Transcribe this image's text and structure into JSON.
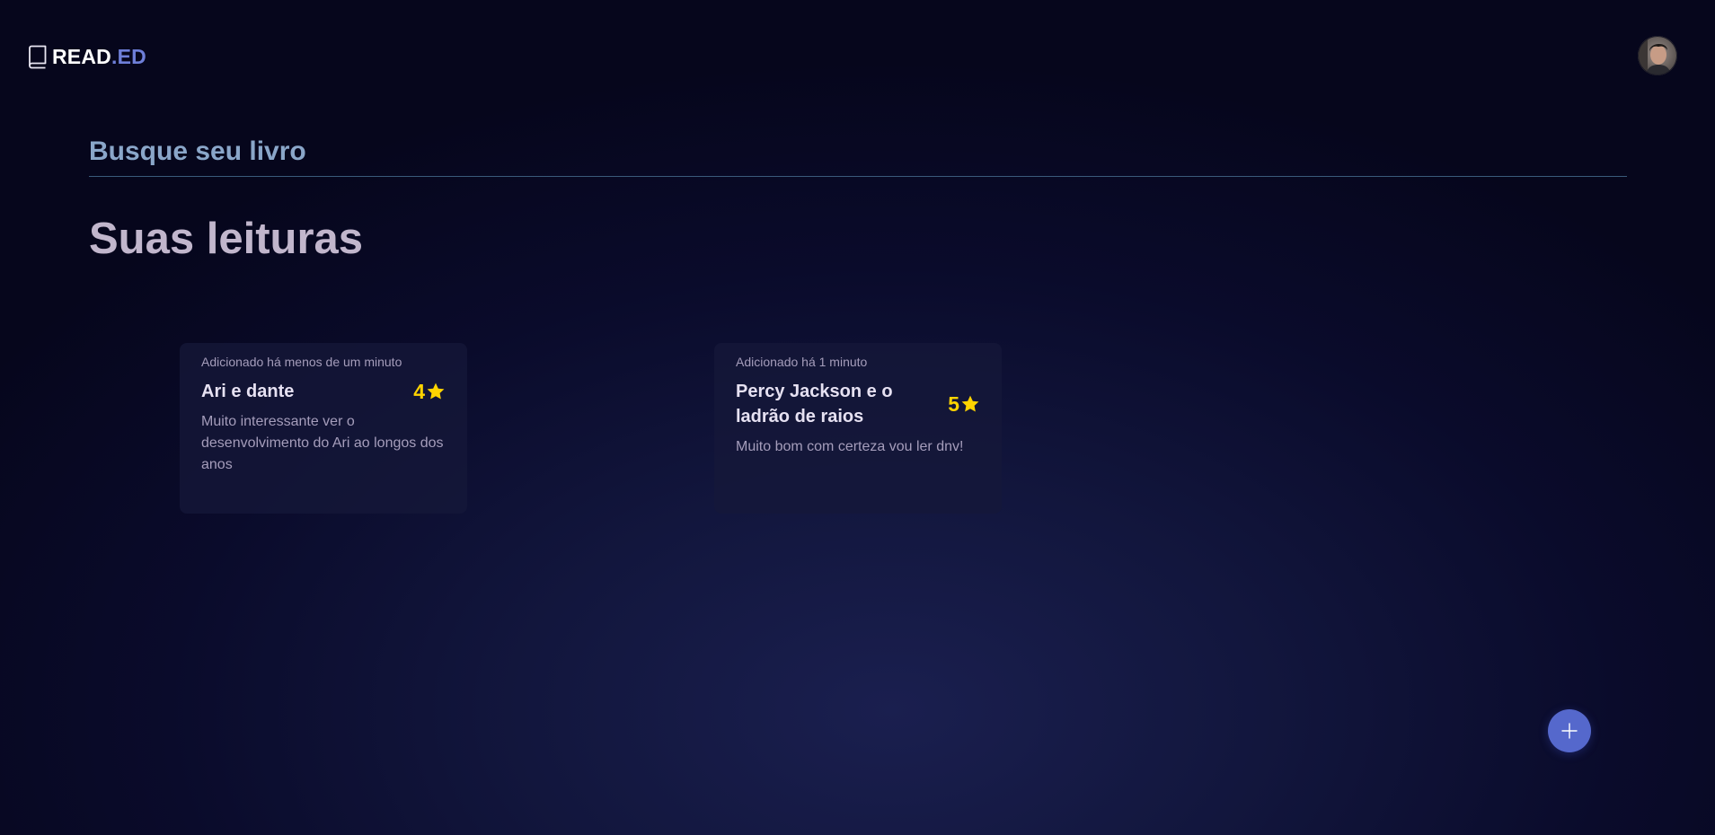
{
  "app": {
    "logo_main": "READ",
    "logo_accent": ".ED",
    "logo_icon": "book-icon"
  },
  "user": {
    "avatar_icon": "user-avatar"
  },
  "search": {
    "placeholder": "Busque seu livro",
    "value": ""
  },
  "section": {
    "title": "Suas leituras"
  },
  "cards": [
    {
      "added": "Adicionado há menos de um minuto",
      "title": "Ari e dante",
      "rating": "4",
      "review": "Muito interessante ver o desenvolvimento do Ari ao longos dos anos"
    },
    {
      "added": "Adicionado há 1 minuto",
      "title": "Percy Jackson e o ladrão de raios",
      "rating": "5",
      "review": "Muito bom com certeza vou ler dnv!"
    }
  ],
  "fab": {
    "icon": "plus-icon"
  },
  "colors": {
    "accent": "#6e7fd9",
    "rating": "#ffd400",
    "fab": "#5568cc",
    "title": "#c1b6cc"
  }
}
